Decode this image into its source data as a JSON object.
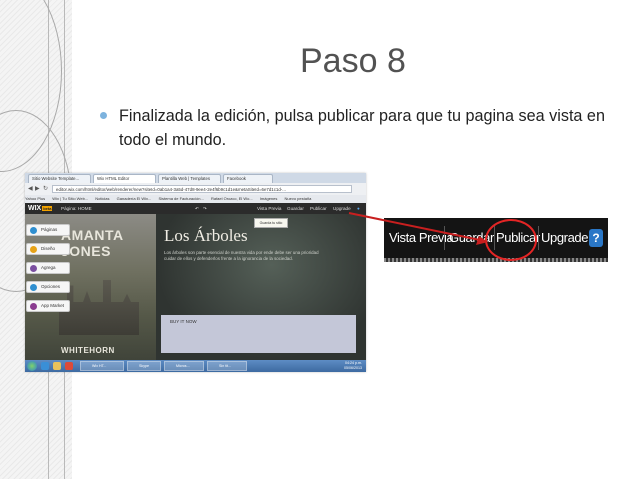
{
  "slide": {
    "title": "Paso 8",
    "bullet": "Finalizada la edición, pulsa publicar para que tu pagina sea vista en todo el mundo."
  },
  "browser": {
    "tabs": [
      "Sitio Website Template...",
      "Wix HTML Editor",
      "Plantilla Web | Templates",
      "Facebook"
    ],
    "url": "editor.wix.com/html/editor/web/renderer/new?siteId=0ab1a4-3a5d-47d8-9ee4-2e4f6b9c1d1e&metaSiteId=6e7d1c1d-...",
    "bookmarks": [
      "Yahoo Plus",
      "Wix | Tu Sitio Web...",
      "Noticias",
      "Ganadería El Wix...",
      "Sistema de Facturación...",
      "Rafael Orozco, El Wo...",
      "Imágenes",
      "Nuevo pestaña"
    ]
  },
  "wix_toolbar": {
    "logo": "WIX",
    "logo_badge": "beta",
    "page_label": "Página: HOME",
    "vista_previa": "Vista Previa",
    "guardar": "Guardar",
    "publicar": "Publicar",
    "upgrade": "Upgrade",
    "tooltip": "Guarda tu sitio"
  },
  "side_panel": {
    "items": [
      {
        "label": "Páginas",
        "color": "#2f8fd0"
      },
      {
        "label": "Diseño",
        "color": "#e7a317"
      },
      {
        "label": "Agrega",
        "color": "#7b4fa0"
      },
      {
        "label": "Opciones",
        "color": "#2f8fd0"
      },
      {
        "label": "App Market",
        "color": "#8a3b8f"
      }
    ]
  },
  "book": {
    "title_line1": "AMANTA",
    "title_line2": "JONES",
    "author": "WHITEHORN"
  },
  "site": {
    "heading": "Los Árboles",
    "text": "Los árboles son parte esencial de nuestra vida por ende debe ser una prioridad cuidar de ellos y defenderlos frente a la ignorancia de la sociedad.",
    "buy_label": "BUY IT NOW"
  },
  "taskbar": {
    "items": [
      "Wix HT...",
      "Skype",
      "Micros...",
      "Sin tit..."
    ],
    "time": "04:24 p.m.",
    "date": "05/06/2013"
  },
  "zoom": {
    "vista_previa": "Vista Previa",
    "guardar": "Guardar",
    "publicar": "Publicar",
    "upgrade": "Upgrade",
    "help": "?"
  },
  "colors": {
    "title": "#525252",
    "bullet": "#7db3de",
    "highlight": "#e42525",
    "help": "#2a77c7"
  }
}
